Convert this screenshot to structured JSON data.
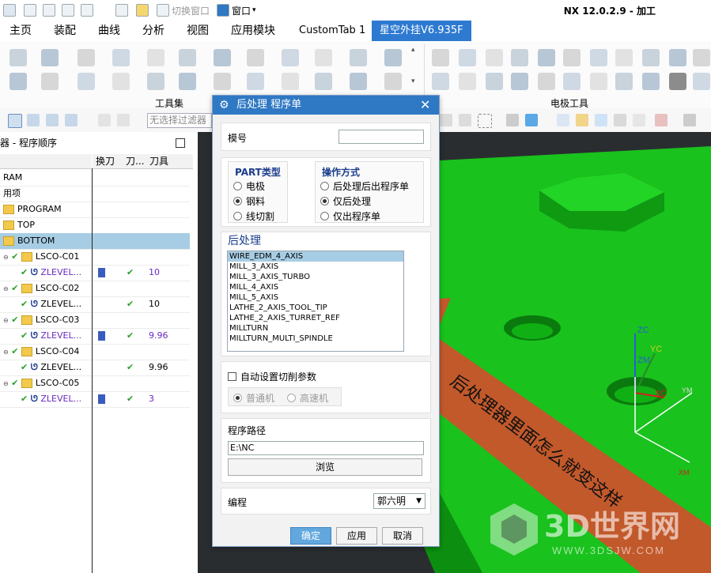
{
  "app_title": "NX 12.0.2.9 - 加工",
  "quick_bar": {
    "switch_window": "切换窗口",
    "window_menu": "窗口"
  },
  "tabs": [
    "主页",
    "装配",
    "曲线",
    "分析",
    "视图",
    "应用模块",
    "CustomTab 1",
    "星空外挂V6.935F"
  ],
  "active_tab": 7,
  "ribbon_groups": {
    "left": "工具集",
    "right": "电极工具"
  },
  "toolbar": {
    "filter_placeholder": "无选择过滤器"
  },
  "navigator": {
    "title": "器 - 程序顺序",
    "columns": [
      "换刀",
      "刀...",
      "刀具"
    ],
    "rows": [
      {
        "name": "RAM",
        "change": "",
        "path": "",
        "tool": "",
        "level": 0,
        "selected": false
      },
      {
        "name": "用项",
        "change": "",
        "path": "",
        "tool": "",
        "level": 0,
        "selected": false
      },
      {
        "name": "PROGRAM",
        "change": "",
        "path": "",
        "tool": "",
        "level": 0,
        "selected": false
      },
      {
        "name": "TOP",
        "change": "",
        "path": "",
        "tool": "",
        "level": 0,
        "selected": false
      },
      {
        "name": "BOTTOM",
        "change": "",
        "path": "",
        "tool": "",
        "level": 0,
        "selected": true
      },
      {
        "name": "LSCO-C01",
        "change": "",
        "path": "",
        "tool": "",
        "level": 1,
        "selected": false
      },
      {
        "name": "ZLEVEL...",
        "change": "tool",
        "path": "✔",
        "tool": "10",
        "level": 2,
        "selected": false
      },
      {
        "name": "LSCO-C02",
        "change": "",
        "path": "",
        "tool": "",
        "level": 1,
        "selected": false
      },
      {
        "name": "ZLEVEL...",
        "change": "",
        "path": "✔",
        "tool": "10",
        "level": 2,
        "selected": false
      },
      {
        "name": "LSCO-C03",
        "change": "",
        "path": "",
        "tool": "",
        "level": 1,
        "selected": false
      },
      {
        "name": "ZLEVEL...",
        "change": "tool",
        "path": "✔",
        "tool": "9.96",
        "level": 2,
        "selected": false
      },
      {
        "name": "LSCO-C04",
        "change": "",
        "path": "",
        "tool": "",
        "level": 1,
        "selected": false
      },
      {
        "name": "ZLEVEL...",
        "change": "",
        "path": "✔",
        "tool": "9.96",
        "level": 2,
        "selected": false
      },
      {
        "name": "LSCO-C05",
        "change": "",
        "path": "",
        "tool": "",
        "level": 1,
        "selected": false
      },
      {
        "name": "ZLEVEL...",
        "change": "tool",
        "path": "✔",
        "tool": "3",
        "level": 2,
        "selected": false
      }
    ]
  },
  "dialog": {
    "title": "后处理 程序单",
    "mold_label": "模号",
    "mold_value": "",
    "part_type_label": "PART类型",
    "part_types": [
      {
        "label": "电极",
        "selected": false
      },
      {
        "label": "钢料",
        "selected": true
      },
      {
        "label": "线切割",
        "selected": false
      }
    ],
    "op_mode_label": "操作方式",
    "op_modes": [
      {
        "label": "后处理后出程序单",
        "selected": false
      },
      {
        "label": "仅后处理",
        "selected": true
      },
      {
        "label": "仅出程序单",
        "selected": false
      }
    ],
    "post_label": "后处理",
    "post_list": [
      "WIRE_EDM_4_AXIS",
      "MILL_3_AXIS",
      "MILL_3_AXIS_TURBO",
      "MILL_4_AXIS",
      "MILL_5_AXIS",
      "LATHE_2_AXIS_TOOL_TIP",
      "LATHE_2_AXIS_TURRET_REF",
      "MILLTURN",
      "MILLTURN_MULTI_SPINDLE"
    ],
    "post_selected": 0,
    "auto_label": "自动设置切削参数",
    "machine_types": [
      {
        "label": "普通机",
        "selected": true
      },
      {
        "label": "高速机",
        "selected": false
      }
    ],
    "path_label": "程序路径",
    "path_value": "E:\\NC",
    "browse": "浏览",
    "programmer_label": "编程",
    "programmer_value": "郭六明",
    "ok": "确定",
    "apply": "应用",
    "cancel": "取消"
  },
  "overlay": {
    "annotation": "后处理器里面怎么就变这样",
    "watermark_main": "3D世界网",
    "watermark_url": "WWW.3DSJW.COM"
  },
  "axes": {
    "zc": "ZC",
    "yc": "YC",
    "zm": "ZM",
    "xc": "XC",
    "ym": "YM",
    "xm": "XM"
  },
  "colors": {
    "accent": "#2f78c4",
    "model_green": "#22c52b",
    "arrow_red": "#e0462e"
  }
}
